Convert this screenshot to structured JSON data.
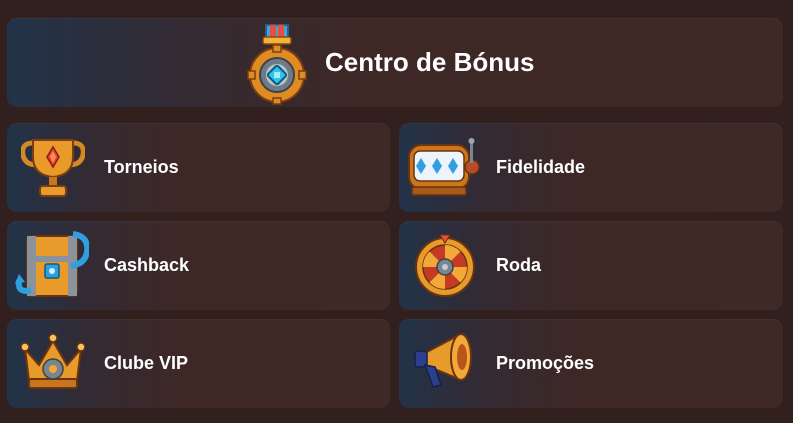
{
  "header": {
    "title": "Centro de Bónus",
    "icon": "medal-gear-icon"
  },
  "tiles": [
    {
      "label": "Torneios",
      "icon": "trophy-icon"
    },
    {
      "label": "Fidelidade",
      "icon": "slot-machine-icon"
    },
    {
      "label": "Cashback",
      "icon": "treasure-chest-icon"
    },
    {
      "label": "Roda",
      "icon": "wheel-icon"
    },
    {
      "label": "Clube VIP",
      "icon": "crown-icon"
    },
    {
      "label": "Promoções",
      "icon": "megaphone-icon"
    }
  ],
  "colors": {
    "page_background": "#32201f",
    "card_background": "#3f2927",
    "card_accent": "#223349",
    "text": "#ffffff",
    "icon_gold": "#e89a2a"
  }
}
